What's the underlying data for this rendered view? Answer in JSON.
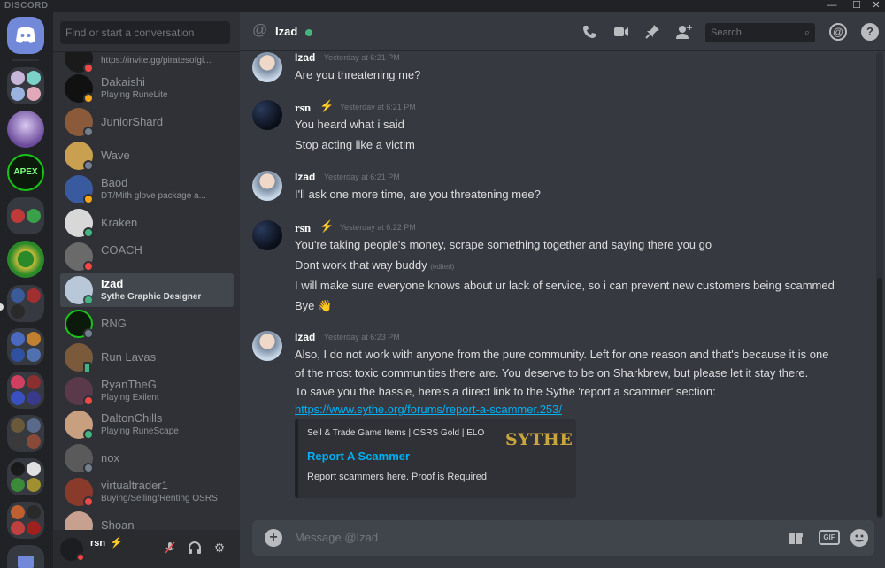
{
  "app": {
    "brand": "DISCORD"
  },
  "window_controls": {
    "minimize": "—",
    "maximize": "☐",
    "close": "✕"
  },
  "sidebar": {
    "search_placeholder": "Find or start a conversation",
    "dms": [
      {
        "name": "",
        "sub": "https://invite.gg/piratesofgi...",
        "status": "dnd"
      },
      {
        "name": "Dakaishi",
        "sub": "Playing RuneLite",
        "status": "idle"
      },
      {
        "name": "JuniorShard",
        "sub": "",
        "status": "offline"
      },
      {
        "name": "Wave",
        "sub": "",
        "status": "offline"
      },
      {
        "name": "Baod",
        "sub": "DT/Mith glove package a...",
        "status": "idle"
      },
      {
        "name": "Kraken",
        "sub": "",
        "status": "online"
      },
      {
        "name": "COACH",
        "sub": "",
        "status": "dnd"
      },
      {
        "name": "Izad",
        "sub": "Sythe Graphic Designer",
        "status": "online"
      },
      {
        "name": "RNG",
        "sub": "",
        "status": "offline"
      },
      {
        "name": "Run Lavas",
        "sub": "",
        "status": "mobile"
      },
      {
        "name": "RyanTheG",
        "sub": "Playing Exilent",
        "status": "dnd"
      },
      {
        "name": "DaltonChills",
        "sub": "Playing RuneScape",
        "status": "online"
      },
      {
        "name": "nox",
        "sub": "",
        "status": "offline"
      },
      {
        "name": "virtualtrader1",
        "sub": "Buying/Selling/Renting OSRS",
        "status": "dnd"
      },
      {
        "name": "Shoan",
        "sub": "",
        "status": "offline"
      }
    ],
    "user": {
      "name": "rsn",
      "tag": ""
    }
  },
  "chat": {
    "title": "Izad",
    "search_placeholder": "Search",
    "composer_placeholder": "Message @Izad",
    "gif_label": "GIF",
    "messages": [
      {
        "author": "Izad",
        "time": "Yesterday at 6:21 PM",
        "lines": [
          "Are you threatening me?"
        ]
      },
      {
        "author": "rsn",
        "time": "Yesterday at 6:21 PM",
        "lines": [
          "You heard what i said",
          "Stop acting like a victim"
        ]
      },
      {
        "author": "Izad",
        "time": "Yesterday at 6:21 PM",
        "lines": [
          "I'll ask one more time, are you threatening mee?"
        ]
      },
      {
        "author": "rsn",
        "time": "Yesterday at 6:22 PM",
        "lines": [
          "You're taking people's money, scrape something together and saying there you go",
          "Dont work that way buddy",
          "I will make sure everyone knows about ur lack of service, so i can prevent new customers being scammed",
          "Bye 👋"
        ],
        "edited": "(edited)"
      },
      {
        "author": "Izad",
        "time": "Yesterday at 6:23 PM",
        "lines": [
          "Also, I do not work with anyone from the pure community. Left for one reason and that's because it is one",
          "of the most toxic communities there are. You deserve to be on Sharkbrew, but please let it stay there.",
          "To save you the hassle, here's a direct link to the Sythe 'report a scammer' section:"
        ],
        "link": "https://www.sythe.org/forums/report-a-scammer.253/"
      }
    ],
    "embed": {
      "provider": "Sell & Trade Game Items | OSRS Gold | ELO",
      "title": "Report A Scammer",
      "description": "Report scammers here. Proof is Required",
      "thumb_text": "SYTHE"
    }
  },
  "colors": {
    "online": "#43b581",
    "idle": "#faa61a",
    "dnd": "#f04747",
    "offline": "#747f8d",
    "link": "#00b0f4",
    "blurple": "#7289da"
  }
}
